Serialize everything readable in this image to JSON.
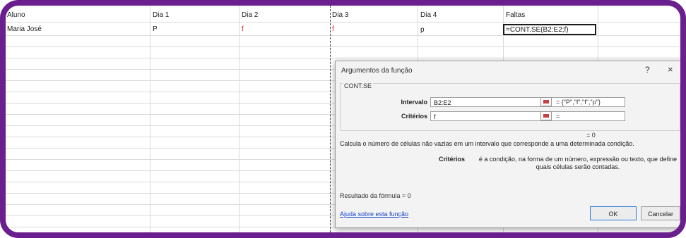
{
  "sheet": {
    "headers": [
      "Aluno",
      "Dia 1",
      "Dia 2",
      "Dia 3",
      "Dia 4",
      "Faltas"
    ],
    "row1": [
      "Maria José",
      "P",
      "f",
      "f",
      "p",
      "=CONT.SE(B2:E2;f)"
    ]
  },
  "dialog": {
    "title": "Argumentos da função",
    "help_glyph": "?",
    "close_glyph": "×",
    "function_name": "CONT.SE",
    "args": [
      {
        "label": "Intervalo",
        "value": "B2:E2",
        "result": "= {\"P\",\"f\",\"f\",\"p\"}"
      },
      {
        "label": "Critérios",
        "value": "f",
        "result": "="
      }
    ],
    "total_result": "= 0",
    "description": "Calcula o número de células não vazias em um intervalo que corresponde a uma determinada condição.",
    "arg_description_name": "Critérios",
    "arg_description": "é a condição, na forma de um número, expressão ou texto, que define quais células serão contadas.",
    "formula_result": "Resultado da fórmula = 0",
    "help_link": "Ajuda sobre esta função",
    "ok_label": "OK",
    "cancel_label": "Cancelar"
  },
  "colors": {
    "frame": "#6a1f8e",
    "error_text": "#e02020",
    "link": "#1a46c8"
  }
}
